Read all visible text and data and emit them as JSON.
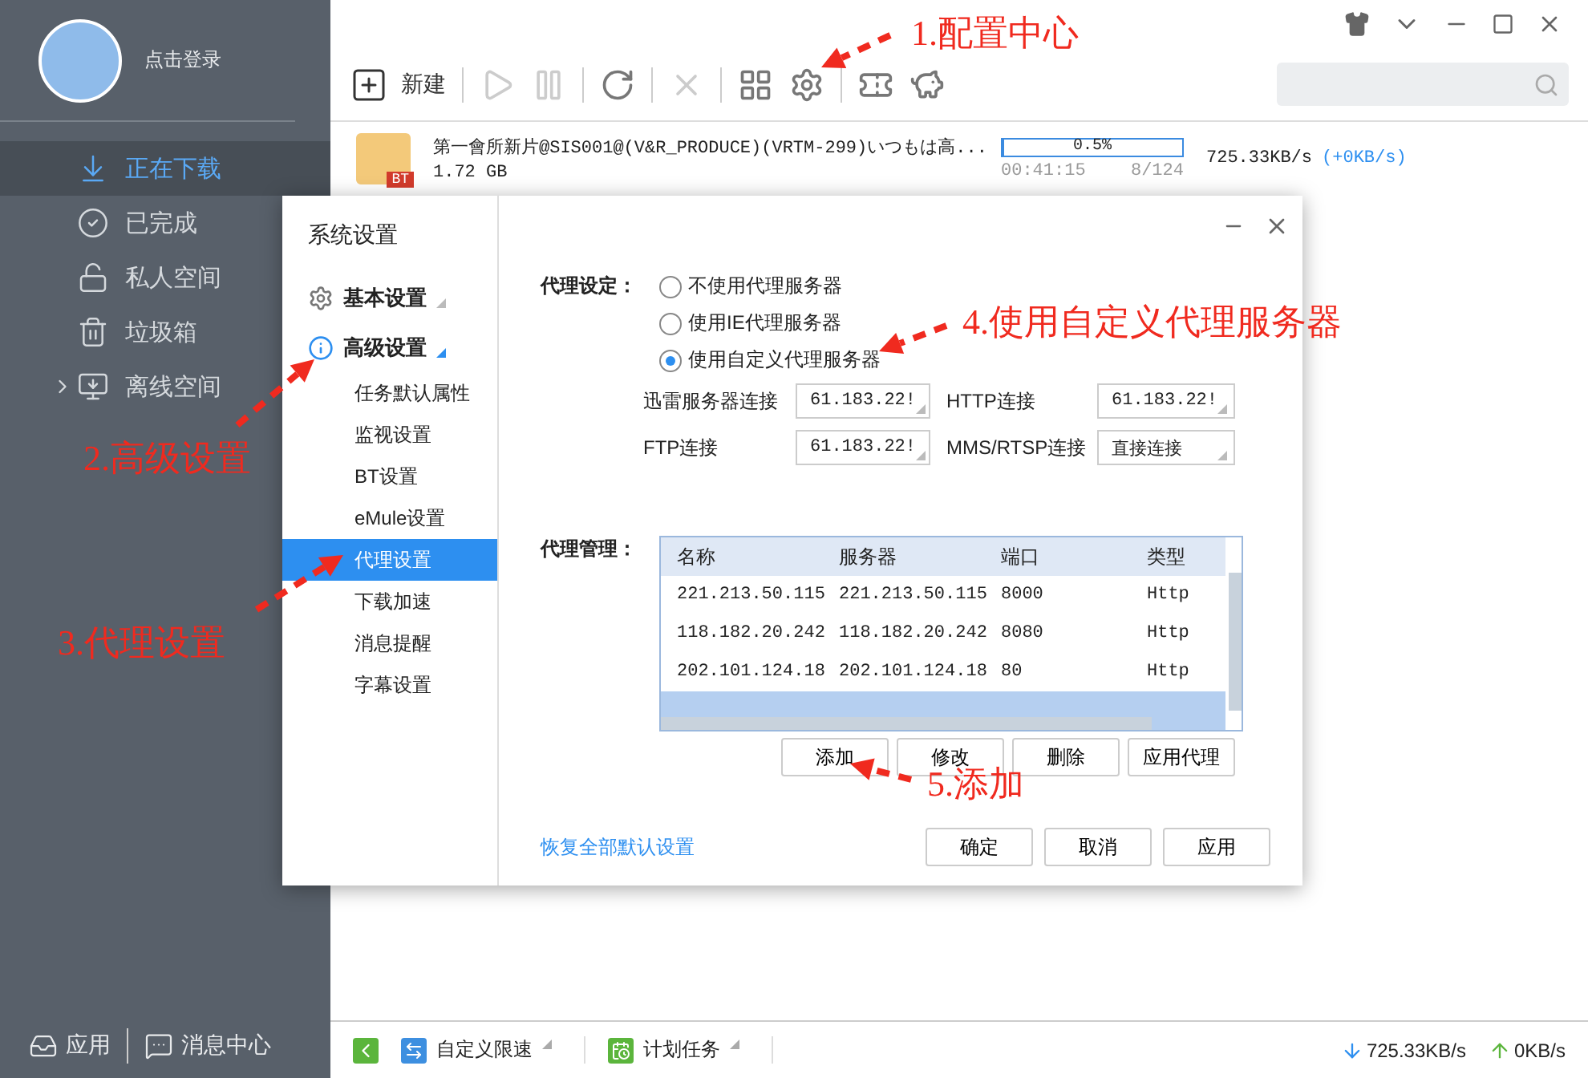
{
  "sidebar": {
    "login_text": "点击登录",
    "nav": [
      {
        "label": "正在下载",
        "selected": true,
        "kind": "download"
      },
      {
        "label": "已完成",
        "selected": false,
        "kind": "done"
      },
      {
        "label": "私人空间",
        "selected": false,
        "kind": "private"
      },
      {
        "label": "垃圾箱",
        "selected": false,
        "kind": "trash"
      },
      {
        "label": "离线空间",
        "selected": false,
        "kind": "offline"
      }
    ],
    "footer": [
      "应用",
      "消息中心"
    ]
  },
  "toolbar": {
    "new_label": "新建"
  },
  "download": {
    "title": "第一會所新片@SIS001@(V&R_PRODUCE)(VRTM-299)いつもは高...",
    "size": "1.72 GB",
    "file_badge": "BT",
    "progress": {
      "level": 0.005,
      "label": "0.5%"
    },
    "elapsed": "00:41:15",
    "pieces": "8/124",
    "speed": "725.33KB/s",
    "boost": "(+0KB/s)"
  },
  "dialog": {
    "title": "系统设置",
    "sections": [
      {
        "label": "基本设置",
        "kind": "basic",
        "expanded": false
      },
      {
        "label": "高级设置",
        "kind": "advanced",
        "expanded": true,
        "children": [
          {
            "label": "任务默认属性",
            "selected": false
          },
          {
            "label": "监视设置",
            "selected": false
          },
          {
            "label": "BT设置",
            "selected": false
          },
          {
            "label": "eMule设置",
            "selected": false
          },
          {
            "label": "代理设置",
            "selected": true
          },
          {
            "label": "下载加速",
            "selected": false
          },
          {
            "label": "消息提醒",
            "selected": false
          },
          {
            "label": "字幕设置",
            "selected": false
          }
        ]
      }
    ],
    "proxy_mode_label": "代理设定：",
    "proxy_options": [
      {
        "label": "不使用代理服务器",
        "selected": false
      },
      {
        "label": "使用IE代理服务器",
        "selected": false
      },
      {
        "label": "使用自定义代理服务器",
        "selected": true
      }
    ],
    "connections": [
      {
        "label": "迅雷服务器连接",
        "value": "61.183.22!"
      },
      {
        "label": "HTTP连接",
        "value": "61.183.22!"
      },
      {
        "label": "FTP连接",
        "value": "61.183.22!"
      },
      {
        "label": "MMS/RTSP连接",
        "value": "直接连接"
      }
    ],
    "proxy_manage_label": "代理管理：",
    "columns": [
      "名称",
      "服务器",
      "端口",
      "类型"
    ],
    "rows": [
      {
        "cells": [
          "221.213.50.115",
          "221.213.50.115",
          "8000",
          "Http"
        ],
        "selected": false
      },
      {
        "cells": [
          "118.182.20.242",
          "118.182.20.242",
          "8080",
          "Http"
        ],
        "selected": false
      },
      {
        "cells": [
          "202.101.124.18",
          "202.101.124.18",
          "80",
          "Http"
        ],
        "selected": false
      },
      {
        "selected": true
      }
    ],
    "table_buttons": [
      "添加",
      "修改",
      "删除",
      "应用代理"
    ],
    "restore_link": "恢复全部默认设置",
    "footer_buttons": [
      "确定",
      "取消",
      "应用"
    ]
  },
  "status_bar": {
    "items": [
      {
        "label": "自定义限速",
        "kind": "speed"
      },
      {
        "label": "计划任务",
        "kind": "schedule"
      }
    ],
    "down_speed": "725.33KB/s",
    "up_speed": "0KB/s"
  },
  "annotations": [
    "1.配置中心",
    "2.高级设置",
    "3.代理设置",
    "4.使用自定义代理服务器",
    "5.添加"
  ]
}
